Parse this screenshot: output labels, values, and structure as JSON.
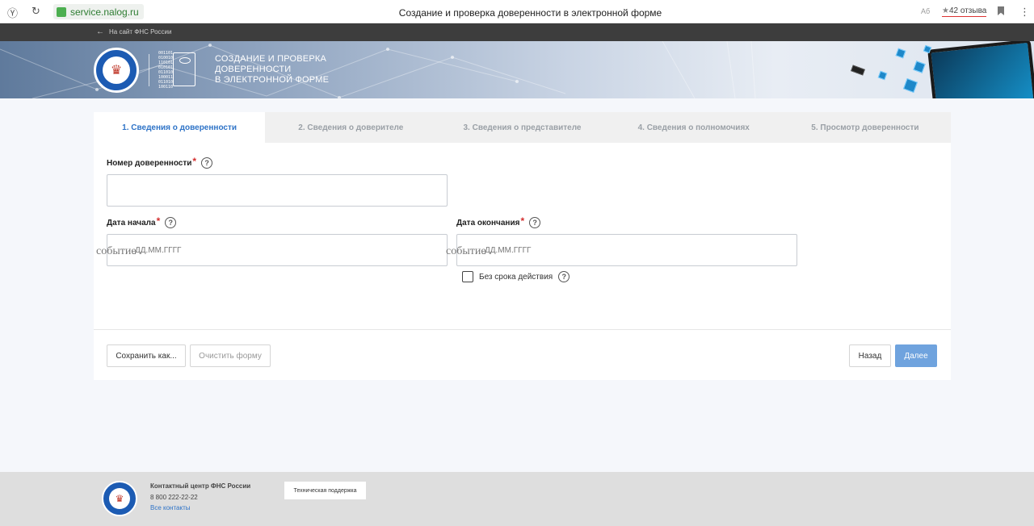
{
  "browser": {
    "url": "service.nalog.ru",
    "title": "Создание и проверка доверенности в электронной форме",
    "reviews": "42 отзыва",
    "reader_label": "Аб"
  },
  "nav": {
    "back_label": "На сайт ФНС России"
  },
  "hero": {
    "title_lines": [
      "Создание и проверка",
      "доверенности",
      "в электронной форме"
    ],
    "binary_lines": [
      "001101",
      "010010",
      "110101",
      "010101",
      "011010",
      "100011",
      "011010",
      "100110"
    ]
  },
  "tabs": [
    {
      "label": "1. Сведения о доверенности",
      "active": true
    },
    {
      "label": "2. Сведения о доверителе",
      "active": false
    },
    {
      "label": "3. Сведения о представителе",
      "active": false
    },
    {
      "label": "4. Сведения о полномочиях",
      "active": false
    },
    {
      "label": "5. Просмотр доверенности",
      "active": false
    }
  ],
  "form": {
    "number_label": "Номер доверенности",
    "number_value": "",
    "start_label": "Дата начала",
    "start_placeholder": "ДД.ММ.ГГГГ",
    "end_label": "Дата окончания",
    "end_placeholder": "ДД.ММ.ГГГГ",
    "overlay_word": "событие",
    "no_expiry_label": "Без срока действия",
    "no_expiry_checked": false,
    "required_mark": "*",
    "help_mark": "?"
  },
  "actions": {
    "save_as": "Сохранить как...",
    "clear": "Очистить форму",
    "back": "Назад",
    "next": "Далее"
  },
  "footer": {
    "title": "Контактный центр ФНС России",
    "phone": "8 800 222-22-22",
    "contacts_link": "Все контакты",
    "support_button": "Техническая поддержка"
  },
  "colors": {
    "accent": "#2e73c7",
    "primary_button": "#6fa3de",
    "required": "#d32f2f"
  }
}
